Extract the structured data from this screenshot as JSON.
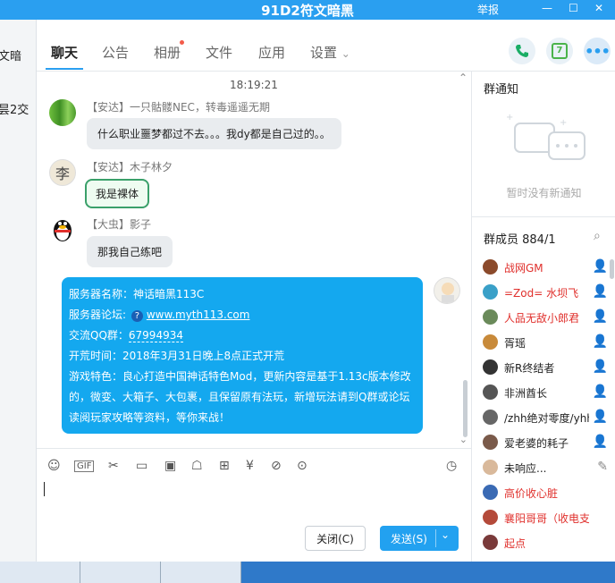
{
  "window": {
    "title": "91D2符文暗黑",
    "report": "举报",
    "minimize": "—",
    "maximize": "☐",
    "close": "✕"
  },
  "left_fragments": [
    "文暗",
    "昙2交"
  ],
  "tabs": [
    {
      "label": "聊天"
    },
    {
      "label": "公告"
    },
    {
      "label": "相册"
    },
    {
      "label": "文件"
    },
    {
      "label": "应用"
    },
    {
      "label": "设置"
    }
  ],
  "settings_chevron": "⌄",
  "top_icons": [
    "phone-icon",
    "calendar-icon",
    "more-icon"
  ],
  "calendar_day": "7",
  "chat": {
    "time": "18:19:21",
    "messages": [
      {
        "sender": "【安达】一只骷髅NEC，转毒遥遥无期",
        "text": "什么职业噩梦都过不去。。。我dy都是自己过的。。"
      },
      {
        "sender": "【安达】木子林夕",
        "text": "我是裸体",
        "avatar_char": "李"
      },
      {
        "sender": "【大虫】影子",
        "text": "那我自己练吧"
      }
    ],
    "notice": {
      "line1_prefix": "服务器名称：",
      "line1_value": "神话暗黑113C",
      "line2_prefix": "服务器论坛: ",
      "line2_value": "www.myth113.com",
      "line3_prefix": "交流QQ群：",
      "line3_value": "67994934",
      "line4": "开荒时间：2018年3月31日晚上8点正式开荒",
      "line5": "游戏特色：良心打造中国神话特色Mod，更新内容是基于1.13c版本修改",
      "line6": "的，微变、大箱子、大包裹，且保留原有法玩，新增玩法请到Q群或论坛",
      "line7": "读阅玩家攻略等资料，等你来战！"
    }
  },
  "toolbar": {
    "gif": "GIF",
    "close_btn": "关闭(C)",
    "send_btn": "发送(S)",
    "send_arrow": "⌄"
  },
  "right": {
    "notice_title": "群通知",
    "notice_empty": "暂时没有新通知",
    "members_title": "群成员 884/1",
    "members": [
      {
        "name": "战网GM",
        "color": "#e0302c"
      },
      {
        "name": "=Zod= 水坝飞",
        "color": "#e0302c"
      },
      {
        "name": "人品无敌小郎君",
        "color": "#e0302c"
      },
      {
        "name": "胥瑶",
        "color": "#222222"
      },
      {
        "name": "新R终结者",
        "color": "#222222"
      },
      {
        "name": "非洲酋长",
        "color": "#222222"
      },
      {
        "name": "/zhh绝对零度/yhh",
        "color": "#222222"
      },
      {
        "name": "爱老婆的耗子",
        "color": "#222222"
      },
      {
        "name": "未响应...",
        "color": "#222222"
      },
      {
        "name": "高价收心脏",
        "color": "#e0302c"
      },
      {
        "name": "襄阳哥哥（收电支）",
        "color": "#e0302c"
      },
      {
        "name": "起点",
        "color": "#e0302c"
      }
    ]
  }
}
